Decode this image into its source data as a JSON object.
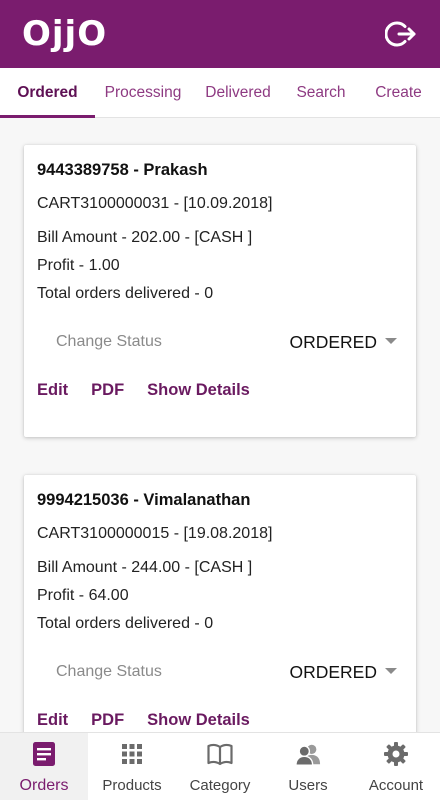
{
  "header": {
    "logo": "OjjO",
    "logout_icon": "logout-icon"
  },
  "colors": {
    "primary": "#7a1c6e",
    "tab_active": "#5e1054",
    "link": "#6a1a60"
  },
  "tabs": [
    {
      "label": "Ordered",
      "active": true
    },
    {
      "label": "Processing"
    },
    {
      "label": "Delivered"
    },
    {
      "label": "Search"
    },
    {
      "label": "Create"
    }
  ],
  "orders": [
    {
      "title": "9443389758 - Prakash",
      "cart": "CART3100000031 - [10.09.2018]",
      "bill": "Bill Amount - 202.00 - [CASH ]",
      "profit": "Profit - 1.00",
      "delivered": "Total orders delivered - 0",
      "status_label": "Change Status",
      "status_value": "ORDERED",
      "actions": {
        "edit": "Edit",
        "pdf": "PDF",
        "details": "Show Details"
      }
    },
    {
      "title": "9994215036 - Vimalanathan",
      "cart": "CART3100000015 - [19.08.2018]",
      "bill": "Bill Amount - 244.00 - [CASH ]",
      "profit": "Profit - 64.00",
      "delivered": "Total orders delivered - 0",
      "status_label": "Change Status",
      "status_value": "ORDERED",
      "actions": {
        "edit": "Edit",
        "pdf": "PDF",
        "details": "Show Details"
      }
    }
  ],
  "bottom_nav": [
    {
      "label": "Orders",
      "icon": "orders-icon",
      "active": true
    },
    {
      "label": "Products",
      "icon": "grid-icon"
    },
    {
      "label": "Category",
      "icon": "book-icon"
    },
    {
      "label": "Users",
      "icon": "users-icon"
    },
    {
      "label": "Account",
      "icon": "gear-icon"
    }
  ]
}
